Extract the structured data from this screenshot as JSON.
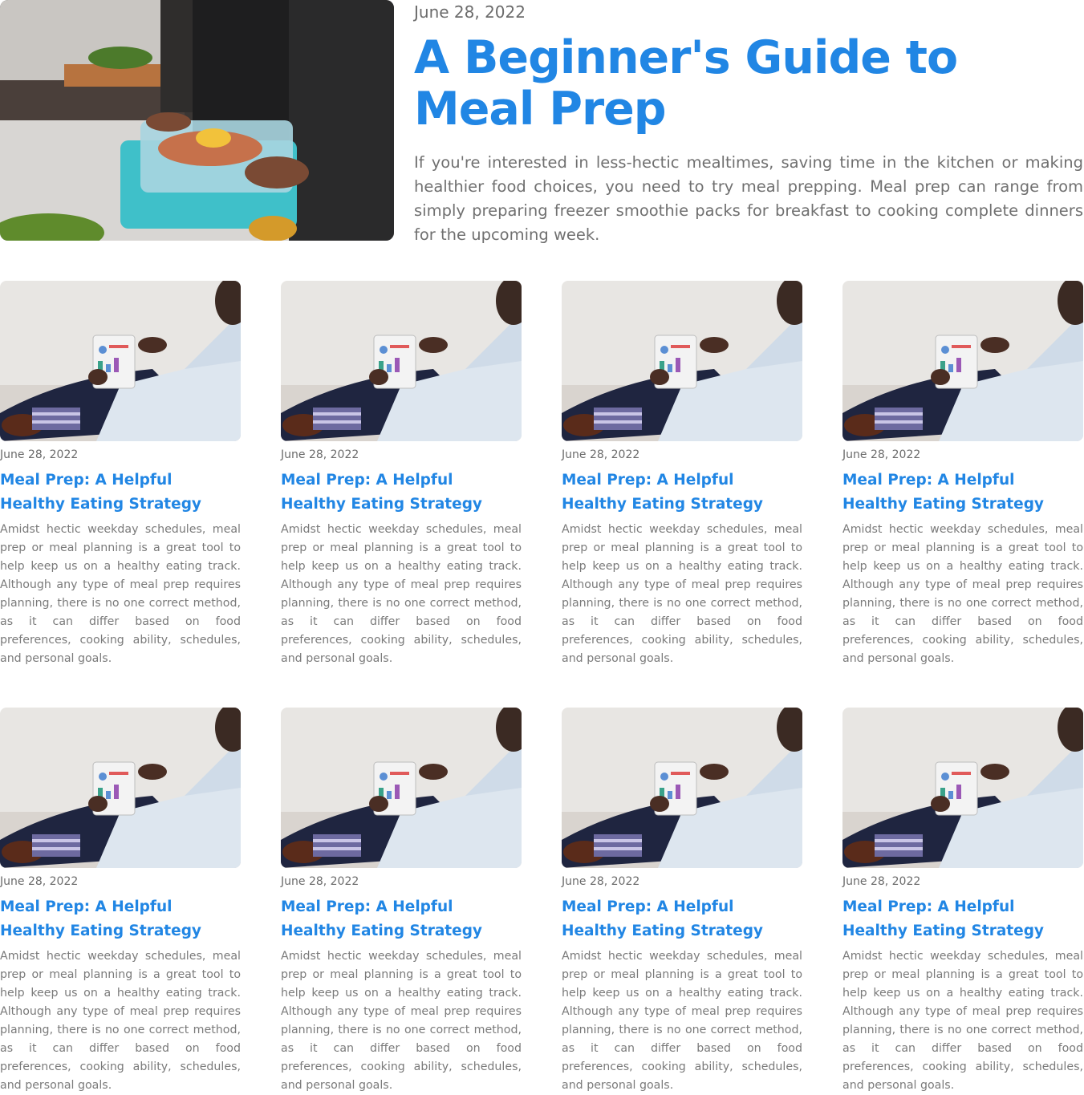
{
  "featured": {
    "date": "June 28, 2022",
    "title": "A Beginner's Guide to Meal Prep",
    "description": "If you're interested in less-hectic mealtimes, saving time in the kitchen or making healthier food choices, you need to try meal prepping. Meal prep can range from simply preparing freezer smoothie packs for breakfast to cooking complete dinners for the upcoming week."
  },
  "cards": [
    {
      "date": "June 28, 2022",
      "title": "Meal Prep: A Helpful Healthy Eating Strategy",
      "description": "Amidst hectic weekday schedules, meal prep or meal planning is a great tool to help keep us on a healthy eating track. Although any type of meal prep requires planning, there is no one correct method, as it can differ based on food preferences, cooking ability, schedules, and personal goals."
    },
    {
      "date": "June 28, 2022",
      "title": "Meal Prep: A Helpful Healthy Eating Strategy",
      "description": "Amidst hectic weekday schedules, meal prep or meal planning is a great tool to help keep us on a healthy eating track. Although any type of meal prep requires planning, there is no one correct method, as it can differ based on food preferences, cooking ability, schedules, and personal goals."
    },
    {
      "date": "June 28, 2022",
      "title": "Meal Prep: A Helpful Healthy Eating Strategy",
      "description": "Amidst hectic weekday schedules, meal prep or meal planning is a great tool to help keep us on a healthy eating track. Although any type of meal prep requires planning, there is no one correct method, as it can differ based on food preferences, cooking ability, schedules, and personal goals."
    },
    {
      "date": "June 28, 2022",
      "title": "Meal Prep: A Helpful Healthy Eating Strategy",
      "description": "Amidst hectic weekday schedules, meal prep or meal planning is a great tool to help keep us on a healthy eating track. Although any type of meal prep requires planning, there is no one correct method, as it can differ based on food preferences, cooking ability, schedules, and personal goals."
    },
    {
      "date": "June 28, 2022",
      "title": "Meal Prep: A Helpful Healthy Eating Strategy",
      "description": "Amidst hectic weekday schedules, meal prep or meal planning is a great tool to help keep us on a healthy eating track. Although any type of meal prep requires planning, there is no one correct method, as it can differ based on food preferences, cooking ability, schedules, and personal goals."
    },
    {
      "date": "June 28, 2022",
      "title": "Meal Prep: A Helpful Healthy Eating Strategy",
      "description": "Amidst hectic weekday schedules, meal prep or meal planning is a great tool to help keep us on a healthy eating track. Although any type of meal prep requires planning, there is no one correct method, as it can differ based on food preferences, cooking ability, schedules, and personal goals."
    },
    {
      "date": "June 28, 2022",
      "title": "Meal Prep: A Helpful Healthy Eating Strategy",
      "description": "Amidst hectic weekday schedules, meal prep or meal planning is a great tool to help keep us on a healthy eating track. Although any type of meal prep requires planning, there is no one correct method, as it can differ based on food preferences, cooking ability, schedules, and personal goals."
    },
    {
      "date": "June 28, 2022",
      "title": "Meal Prep: A Helpful Healthy Eating Strategy",
      "description": "Amidst hectic weekday schedules, meal prep or meal planning is a great tool to help keep us on a healthy eating track. Although any type of meal prep requires planning, there is no one correct method, as it can differ based on food preferences, cooking ability, schedules, and personal goals."
    }
  ],
  "colors": {
    "accent": "#2186e4",
    "text": "#6b6b6b"
  }
}
